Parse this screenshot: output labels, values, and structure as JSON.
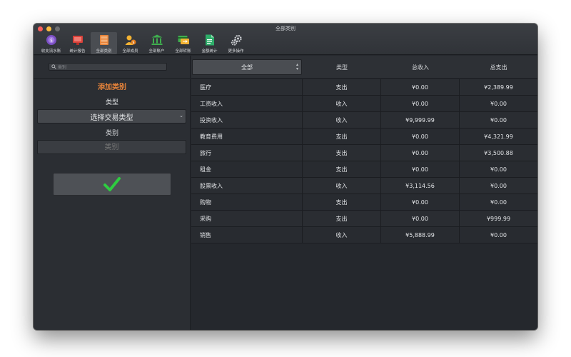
{
  "window": {
    "title": "全部类别"
  },
  "toolbar": {
    "items": [
      {
        "label": "收支流水账",
        "icon": "ledger-icon"
      },
      {
        "label": "统计报告",
        "icon": "report-icon"
      },
      {
        "label": "全部类别",
        "icon": "categories-icon"
      },
      {
        "label": "全部成员",
        "icon": "members-icon"
      },
      {
        "label": "全部账户",
        "icon": "bank-icon"
      },
      {
        "label": "全部转账",
        "icon": "transfer-icon"
      },
      {
        "label": "金额统计",
        "icon": "amount-stats-icon"
      },
      {
        "label": "更多操作",
        "icon": "gears-icon"
      }
    ]
  },
  "sidebar": {
    "search_placeholder": "类别",
    "add_title": "添加类别",
    "type_label": "类型",
    "type_select_value": "选择交易类型",
    "category_label": "类别",
    "category_placeholder": "类别",
    "confirm_icon": "checkmark-icon"
  },
  "table": {
    "filter_value": "全部",
    "headers": [
      "类型",
      "总收入",
      "总支出"
    ],
    "rows": [
      {
        "name": "医疗",
        "type": "支出",
        "income": "¥0.00",
        "expense": "¥2,389.99"
      },
      {
        "name": "工资收入",
        "type": "收入",
        "income": "¥0.00",
        "expense": "¥0.00"
      },
      {
        "name": "投资收入",
        "type": "收入",
        "income": "¥9,999.99",
        "expense": "¥0.00"
      },
      {
        "name": "教育费用",
        "type": "支出",
        "income": "¥0.00",
        "expense": "¥4,321.99"
      },
      {
        "name": "旅行",
        "type": "支出",
        "income": "¥0.00",
        "expense": "¥3,500.88"
      },
      {
        "name": "租金",
        "type": "支出",
        "income": "¥0.00",
        "expense": "¥0.00"
      },
      {
        "name": "股票收入",
        "type": "收入",
        "income": "¥3,114.56",
        "expense": "¥0.00"
      },
      {
        "name": "购物",
        "type": "支出",
        "income": "¥0.00",
        "expense": "¥0.00"
      },
      {
        "name": "采购",
        "type": "支出",
        "income": "¥0.00",
        "expense": "¥999.99"
      },
      {
        "name": "销售",
        "type": "收入",
        "income": "¥5,888.99",
        "expense": "¥0.00"
      }
    ]
  },
  "colors": {
    "accent_orange": "#e8843a",
    "check_green": "#2ecc40"
  }
}
